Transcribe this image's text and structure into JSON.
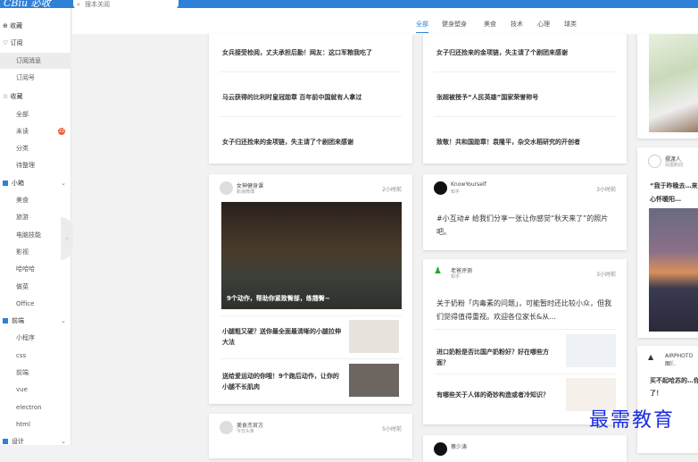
{
  "header": {
    "logo": "CBiu 必收",
    "search_placeholder": "搜本关阅"
  },
  "sidebar": {
    "add": "收藏",
    "subscribe": "订阅",
    "sub_items": [
      "订阅消息",
      "订阅号"
    ],
    "favorites": "收藏",
    "fav_items": [
      "全部",
      "未读",
      "分类",
      "待整理"
    ],
    "unread_count": "22",
    "groups": [
      {
        "name": "小箱",
        "items": [
          "美食",
          "旅游",
          "电脑技能",
          "影视",
          "哈哈哈",
          "做菜",
          "Office"
        ]
      },
      {
        "name": "前端",
        "items": [
          "小程序",
          "css",
          "前端",
          "vue",
          "electron",
          "html"
        ]
      },
      {
        "name": "设计",
        "items": []
      }
    ]
  },
  "tabs": [
    "全部",
    "健身塑身",
    "美食",
    "技术",
    "心理",
    "球类"
  ],
  "col1": {
    "news": [
      "女兵接受检阅，丈夫承担后勤！网友：这口军粮我吃了",
      "马云获得的比利时皇冠勋章 百年前中国就有人拿过",
      "女子归还捡来的金项链，失主请了个剧团来感谢"
    ],
    "card2": {
      "author": "女神健身课",
      "source": "新浪微博",
      "time": "2小时前",
      "caption": "9个动作，帮助你紧致臀部，练翘臀~",
      "items": [
        "小腿粗又硬？送你最全面最清晰的小腿拉伸大法",
        "送给爱运动的你哦！9个跑后动作，让你的小腿不长肌肉"
      ]
    },
    "card3": {
      "author": "美食杰官方",
      "source": "今日头条",
      "time": "5小时前"
    }
  },
  "col2": {
    "news": [
      "女子归还捡来的金项链，失主请了个剧团来感谢",
      "张超被授予“人民英雄”国家荣誉称号",
      "致敬！共和国勋章！袁隆平，杂交水稻研究的开创者"
    ],
    "card2": {
      "author": "KnowYourself",
      "source": "知乎",
      "time": "3小时前",
      "text": "#小互动# 给我们分享一张让你感觉“秋天来了”的照片吧。"
    },
    "card3": {
      "author": "老爸评测",
      "source": "知乎",
      "time": "3小时前",
      "text": "关于奶粉「内毒素的问题」，可能暂时还比较小众，但我们觉得值得重视。欢迎各位家长&从...",
      "items": [
        "进口奶粉是否比国产奶粉好？好在哪些方面？",
        "有哪些关于人体的奇妙构造或者冷知识？"
      ]
    },
    "card4": {
      "author": "蔡少涛"
    }
  },
  "col3": {
    "card2": {
      "author": "摆渡人",
      "source": "凤凰新闻",
      "text": "“我于昨晚去…来到心怀暖阳…"
    },
    "card3": {
      "author": "AIRPHOTO图…",
      "source": "知乎",
      "text": "买不起哈苏的…你了！"
    }
  },
  "watermark": "最需教育"
}
